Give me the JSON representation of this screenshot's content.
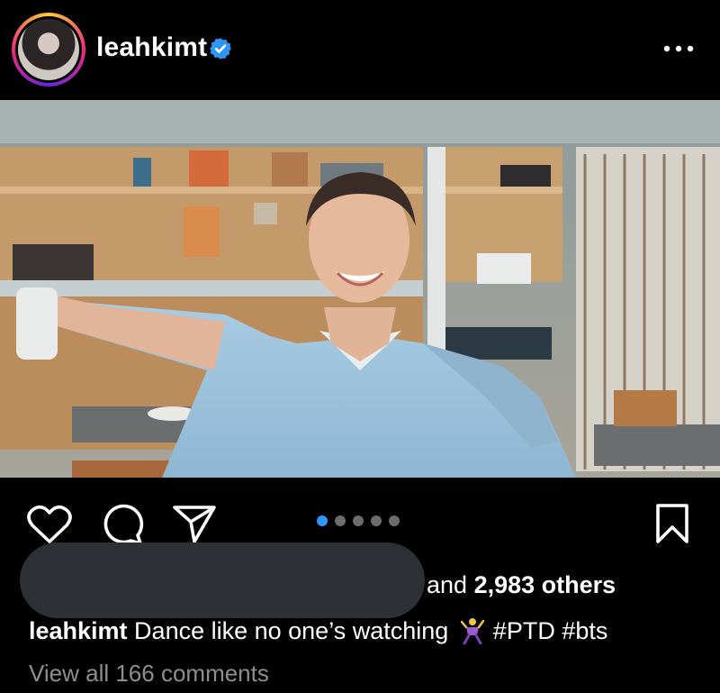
{
  "post": {
    "username": "leahkimt",
    "verified_icon": "verified-badge-icon",
    "more_icon": "more-options-icon"
  },
  "media": {
    "carousel_count": 5,
    "carousel_active": 1
  },
  "actions": {
    "like_icon": "heart-icon",
    "comment_icon": "comment-icon",
    "share_icon": "send-icon",
    "save_icon": "bookmark-icon"
  },
  "likes": {
    "prefix": "and ",
    "count": "2,983 others"
  },
  "caption": {
    "username": "leahkimt",
    "text": " Dance like no one’s watching",
    "emoji_icon": "dancing-man-emoji-icon",
    "hashtags": "#PTD #bts"
  },
  "comments": {
    "link": "View all 166 comments"
  },
  "colors": {
    "background": "#000000",
    "accent_blue": "#2f95f6",
    "muted_text": "#8e8e8e",
    "redaction": "#2d3135"
  }
}
